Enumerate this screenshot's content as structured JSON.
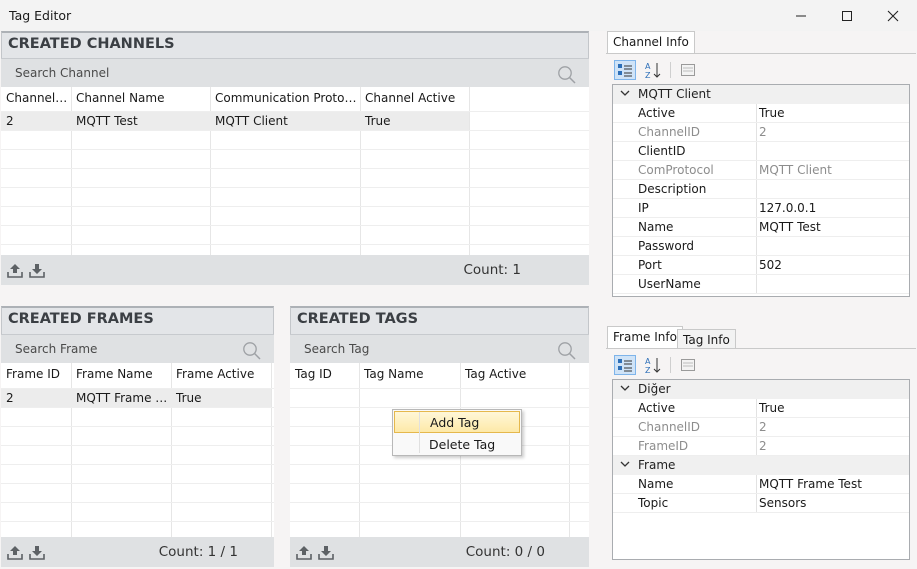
{
  "window": {
    "title": "Tag Editor"
  },
  "channels": {
    "title": "CREATED CHANNELS",
    "search_placeholder": "Search Channel",
    "columns": [
      "Channel ID",
      "Channel Name",
      "Communication Protocol",
      "Channel Active"
    ],
    "rows": [
      [
        "2",
        "MQTT Test",
        "MQTT Client",
        "True"
      ]
    ],
    "count": "Count: 1"
  },
  "frames": {
    "title": "CREATED FRAMES",
    "search_placeholder": "Search Frame",
    "columns": [
      "Frame ID",
      "Frame Name",
      "Frame Active"
    ],
    "rows": [
      [
        "2",
        "MQTT Frame Test",
        "True"
      ]
    ],
    "count": "Count: 1 / 1"
  },
  "tags": {
    "title": "CREATED TAGS",
    "search_placeholder": "Search Tag",
    "columns": [
      "Tag ID",
      "Tag Name",
      "Tag Active"
    ],
    "count": "Count: 0 / 0"
  },
  "context_menu": {
    "items": [
      "Add Tag",
      "Delete Tag"
    ]
  },
  "channel_info": {
    "tab": "Channel Info",
    "category": "MQTT Client",
    "props": [
      {
        "name": "Active",
        "value": "True",
        "readonly": false
      },
      {
        "name": "ChannelID",
        "value": "2",
        "readonly": true
      },
      {
        "name": "ClientID",
        "value": "",
        "readonly": false
      },
      {
        "name": "ComProtocol",
        "value": "MQTT Client",
        "readonly": true
      },
      {
        "name": "Description",
        "value": "",
        "readonly": false
      },
      {
        "name": "IP",
        "value": "127.0.0.1",
        "readonly": false
      },
      {
        "name": "Name",
        "value": "MQTT Test",
        "readonly": false
      },
      {
        "name": "Password",
        "value": "",
        "readonly": false
      },
      {
        "name": "Port",
        "value": "502",
        "readonly": false
      },
      {
        "name": "UserName",
        "value": "",
        "readonly": false
      }
    ]
  },
  "frame_info": {
    "tabs": [
      "Frame Info",
      "Tag Info"
    ],
    "categories": [
      {
        "name": "Diğer",
        "props": [
          {
            "name": "Active",
            "value": "True",
            "readonly": false
          },
          {
            "name": "ChannelID",
            "value": "2",
            "readonly": true
          },
          {
            "name": "FrameID",
            "value": "2",
            "readonly": true
          }
        ]
      },
      {
        "name": "Frame",
        "props": [
          {
            "name": "Name",
            "value": "MQTT Frame Test",
            "readonly": false
          },
          {
            "name": "Topic",
            "value": "Sensors",
            "readonly": false
          }
        ]
      }
    ]
  }
}
